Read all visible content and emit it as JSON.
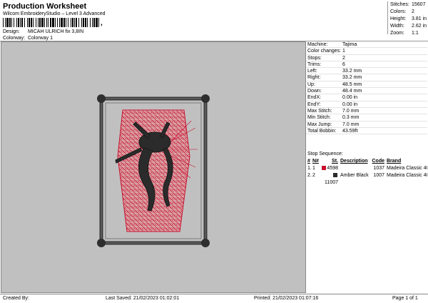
{
  "header": {
    "title": "Production Worksheet",
    "subtitle": "Wilcom EmbroideryStudio – Level 3 Advanced",
    "barcode_suffix": ","
  },
  "design_info": {
    "design_label": "Design:",
    "design_value": "MICAH ULRICH fix 3,8IN",
    "colorway_label": "Colorway:",
    "colorway_value": "Colorway 1"
  },
  "summary": {
    "stitches_label": "Stitches:",
    "stitches": "15607",
    "colors_label": "Colors:",
    "colors": "2",
    "height_label": "Height:",
    "height": "3.81 in",
    "width_label": "Width:",
    "width": "2.62 in",
    "zoom_label": "Zoom:",
    "zoom": "1:1"
  },
  "specs": [
    {
      "label": "Machine:",
      "value": "Tajima"
    },
    {
      "label": "Color changes:",
      "value": "1"
    },
    {
      "label": "Stops:",
      "value": "2"
    },
    {
      "label": "Trims:",
      "value": "6"
    },
    {
      "label": "Left:",
      "value": "33.2 mm"
    },
    {
      "label": "Right:",
      "value": "33.2 mm"
    },
    {
      "label": "Up:",
      "value": "48.5 mm"
    },
    {
      "label": "Down:",
      "value": "48.4 mm"
    },
    {
      "label": "EndX:",
      "value": "0.00 in"
    },
    {
      "label": "EndY:",
      "value": "0.00 in"
    },
    {
      "label": "Max Stitch:",
      "value": "7.0 mm"
    },
    {
      "label": "Min Stitch:",
      "value": "0.3 mm"
    },
    {
      "label": "Max Jump:",
      "value": "7.0 mm"
    },
    {
      "label": "Total Bobbin:",
      "value": "43.59ft"
    }
  ],
  "stop_sequence": {
    "title": "Stop Sequence:",
    "headers": [
      "#",
      "N#",
      "St.",
      "Description",
      "Code",
      "Brand"
    ],
    "rows": [
      {
        "num": "1.",
        "n": "1",
        "color": "#c8102e",
        "st": "4598",
        "desc": "",
        "code": "1037",
        "brand": "Madeira Classic 40"
      },
      {
        "num": "2.",
        "n": "2",
        "color": "#2b2b2b",
        "st": "11007",
        "desc": "Amber Black",
        "code": "1007",
        "brand": "Madeira Classic 40"
      }
    ]
  },
  "footer": {
    "created_by": "Created By:",
    "last_saved": "Last Saved: 21/02/2023 01:02:01",
    "printed": "Printed: 21/02/2023 01:07:16",
    "page": "Page 1 of 1"
  },
  "colors": {
    "preview_bg": "#c0c0c0",
    "thread_red": "#c8102e",
    "thread_black": "#2b2b2b"
  }
}
